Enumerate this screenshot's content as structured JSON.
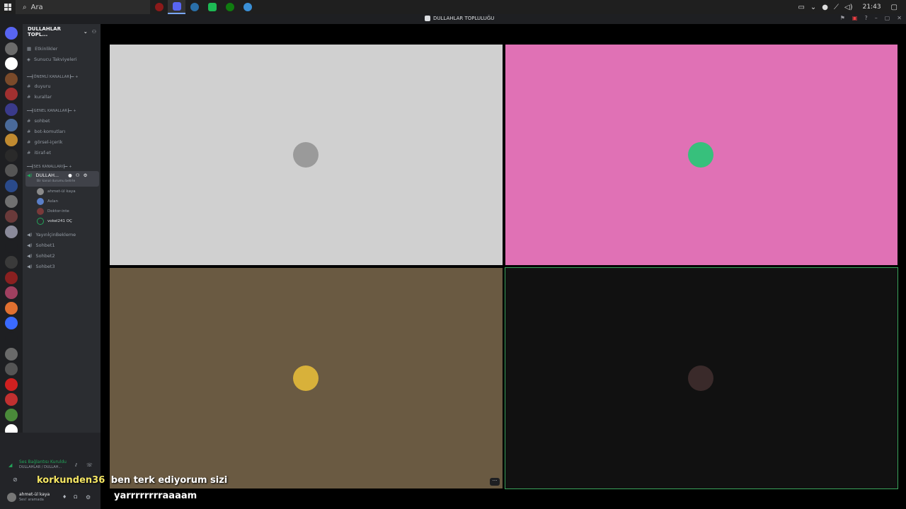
{
  "taskbar": {
    "search_placeholder": "Ara",
    "clock": "21:43",
    "apps": [
      "game-icon",
      "discord-icon",
      "steam-icon",
      "app-icon",
      "xbox-icon",
      "network-icon"
    ]
  },
  "window": {
    "title": "DULLAHLAR TOPLULUĞU"
  },
  "server": {
    "name": "DULLAHLAR TOPL...",
    "events_label": "Etkinlikler",
    "boost_label": "Sunucu Takviyeleri",
    "categories": {
      "important": "ÖNEMLİ KANALLAR",
      "general": "GENEL KANALLAR",
      "voice": "SES KANALLARI"
    },
    "important_channels": [
      "duyuru",
      "kurallar"
    ],
    "general_channels": [
      "sohbet",
      "bot-komutları",
      "görsel-içerik",
      "itiraf-et"
    ],
    "active_voice": {
      "name": "DULLAH...",
      "status": "Bir kanal durumu belirle"
    },
    "voice_users": [
      "ahmet-ül kaya",
      "Aslan",
      "Doktor-inte",
      "vokel241 OÇ"
    ],
    "voice_channels": [
      "YayınİçinBekleme",
      "Sohbet1",
      "Sohbet2",
      "Sohbet3"
    ]
  },
  "user_panel": {
    "connection": "Ses Bağlantısı Kuruldu",
    "location": "DULLAHLAR / DULLAH...",
    "username": "ahmet-ül kaya",
    "user_status": "Ses! aramada"
  },
  "tiles": [
    {
      "bg": "#d0d0d0",
      "avatar": "#9a9a9a",
      "border": ""
    },
    {
      "bg": "#e071b5",
      "avatar": "#37c07c",
      "border": ""
    },
    {
      "bg": "#6a5a42",
      "avatar": "#d8b13a",
      "border": ""
    },
    {
      "bg": "#111111",
      "avatar": "#3a2a2a",
      "border": "#3ba55d"
    }
  ],
  "subtitles": {
    "line1_user": "korkunden36",
    "line1_text": "ben terk ediyorum sizi",
    "line2_text": "yarrrrrrrraaaam"
  },
  "colors": {
    "taskbar": "#1f1f1f",
    "discord_dark": "#1e1f22",
    "sidebar": "#2b2d31",
    "speaking_green": "#3ba55d",
    "subtitle_user": "#f5e663",
    "subtitle_text": "#ffffff"
  }
}
